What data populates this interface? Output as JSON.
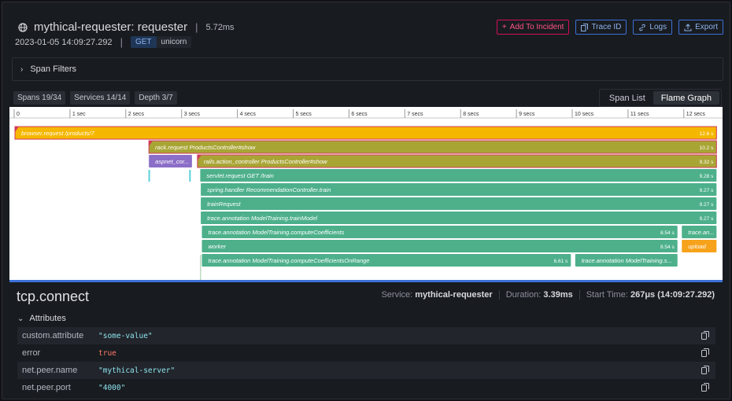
{
  "header": {
    "title": "mythical-requester: requester",
    "duration": "5.72ms",
    "timestamp": "2023-01-05 14:09:27.292",
    "method": "GET",
    "service": "unicorn"
  },
  "actions": {
    "add_incident": "Add To Incident",
    "trace_id": "Trace ID",
    "logs": "Logs",
    "export": "Export"
  },
  "filters": {
    "label": "Span Filters"
  },
  "stats": {
    "spans": "Spans 19/34",
    "services": "Services 14/14",
    "depth": "Depth 3/7"
  },
  "view": {
    "span_list": "Span List",
    "flame_graph": "Flame Graph",
    "active": "Flame Graph"
  },
  "flame": {
    "ticks": [
      "0",
      "1 sec",
      "2 secs",
      "3 secs",
      "4 secs",
      "5 secs",
      "6 secs",
      "7 secs",
      "8 secs",
      "9 secs",
      "10 secs",
      "11 secs",
      "12 secs"
    ],
    "spans": [
      {
        "name": "browser.request /products/7",
        "duration": "12.6 s",
        "start": 0,
        "end": 12.6,
        "row": 0,
        "color": "#f5b700",
        "text": "#ffffff"
      },
      {
        "name": "rack.request ProductsController#show",
        "duration": "10.2 s",
        "start": 2.4,
        "end": 12.6,
        "row": 1,
        "color": "#a9a535",
        "text": "#ffffff"
      },
      {
        "name": "aspnet_cor...",
        "duration": "",
        "start": 2.4,
        "end": 3.2,
        "row": 2,
        "color": "#8b6ec7",
        "text": "#ffffff"
      },
      {
        "name": "rails.action_controller ProductsController#show",
        "duration": "9.32 s",
        "start": 3.27,
        "end": 12.6,
        "row": 2,
        "color": "#a9a535",
        "text": "#ffffff"
      },
      {
        "name": "servlet.request GET /train",
        "duration": "9.28 s",
        "start": 3.32,
        "end": 12.6,
        "row": 3,
        "color": "#4db08b",
        "text": "#ffffff"
      },
      {
        "name": "spring.handler RecommendationController.train",
        "duration": "9.27 s",
        "start": 3.33,
        "end": 12.6,
        "row": 4,
        "color": "#4db08b",
        "text": "#ffffff"
      },
      {
        "name": "trainRequest",
        "duration": "9.27 s",
        "start": 3.33,
        "end": 12.6,
        "row": 5,
        "color": "#4db08b",
        "text": "#ffffff"
      },
      {
        "name": "trace.annotation ModelTraining.trainModel",
        "duration": "9.27 s",
        "start": 3.33,
        "end": 12.6,
        "row": 6,
        "color": "#4db08b",
        "text": "#ffffff"
      },
      {
        "name": "trace.annotation ModelTraining.computeCoefficients",
        "duration": "8.54 s",
        "start": 3.35,
        "end": 11.9,
        "row": 7,
        "color": "#4db08b",
        "text": "#ffffff"
      },
      {
        "name": "trace.an...",
        "duration": "",
        "start": 11.95,
        "end": 12.6,
        "row": 7,
        "color": "#4db08b",
        "text": "#ffffff"
      },
      {
        "name": "worker",
        "duration": "8.54 s",
        "start": 3.35,
        "end": 11.9,
        "row": 8,
        "color": "#4db08b",
        "text": "#ffffff"
      },
      {
        "name": "upload",
        "duration": "",
        "start": 11.95,
        "end": 12.6,
        "row": 8,
        "color": "#f7a21b",
        "text": "#ffffff"
      },
      {
        "name": "trace.annotation ModelTraining.computeCoefficientsOnRange",
        "duration": "6.61 s",
        "start": 3.35,
        "end": 9.99,
        "row": 9,
        "color": "#4db08b",
        "text": "#ffffff"
      },
      {
        "name": "trace.annotation ModelTraining.s...",
        "duration": "",
        "start": 10.04,
        "end": 11.9,
        "row": 9,
        "color": "#4db08b",
        "text": "#ffffff"
      }
    ]
  },
  "detail": {
    "name": "tcp.connect",
    "service_label": "Service:",
    "service": "mythical-requester",
    "duration_label": "Duration:",
    "duration": "3.39ms",
    "start_label": "Start Time:",
    "start": "267μs (14:09:27.292)"
  },
  "attributes": {
    "label": "Attributes",
    "rows": [
      {
        "key": "custom.attribute",
        "value": "\"some-value\"",
        "kind": "str"
      },
      {
        "key": "error",
        "value": "true",
        "kind": "bool"
      },
      {
        "key": "net.peer.name",
        "value": "\"mythical-server\"",
        "kind": "str"
      },
      {
        "key": "net.peer.port",
        "value": "\"4000\"",
        "kind": "str"
      }
    ]
  }
}
